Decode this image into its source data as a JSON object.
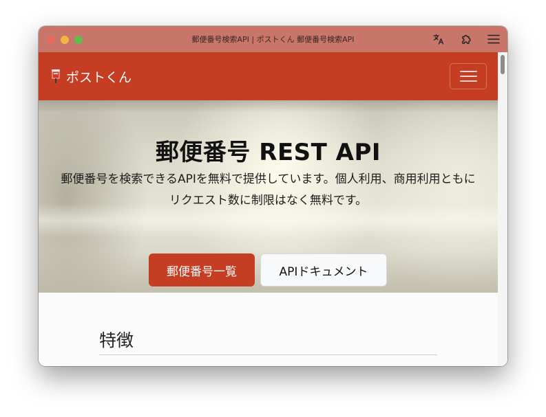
{
  "window": {
    "title": "郵便番号検索API | ポストくん 郵便番号検索API",
    "toolbar_icons": [
      "translate-icon",
      "extension-icon",
      "hamburger-menu-icon"
    ]
  },
  "navbar": {
    "brand_icon": "postbox-icon",
    "brand": "ポストくん",
    "toggler_icon": "hamburger-icon",
    "color": "#c53d22"
  },
  "hero": {
    "title": "郵便番号 REST API",
    "lead": "郵便番号を検索できるAPIを無料で提供しています。個人利用、商用利用ともにリクエスト数に制限はなく無料です。",
    "primary_button": "郵便番号一覧",
    "secondary_button": "APIドキュメント"
  },
  "features": {
    "title": "特徴"
  },
  "colors": {
    "accent": "#c53d22",
    "titlebar": "#c8766a"
  }
}
